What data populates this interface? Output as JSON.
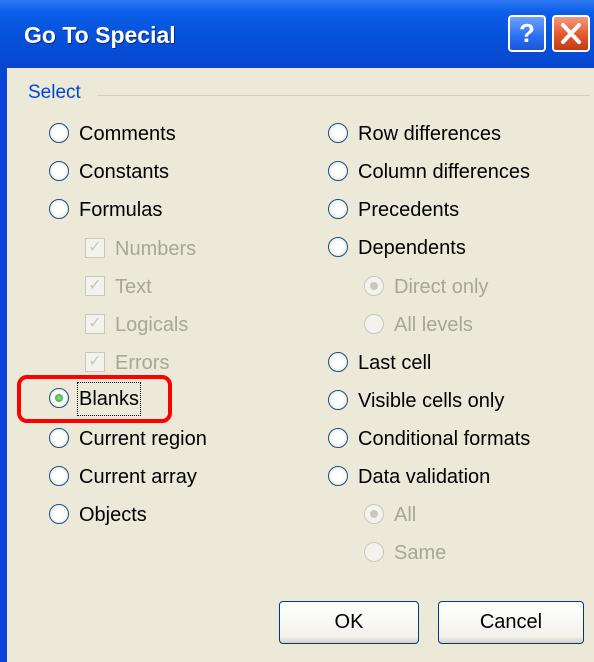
{
  "window": {
    "title": "Go To Special",
    "help_label": "?",
    "close_label": "✕"
  },
  "group": {
    "label": "Select"
  },
  "left_options": [
    {
      "label": "Comments",
      "selected": false
    },
    {
      "label": "Constants",
      "selected": false
    },
    {
      "label": "Formulas",
      "selected": false
    },
    {
      "label": "Numbers",
      "checked": true,
      "disabled": true
    },
    {
      "label": "Text",
      "checked": true,
      "disabled": true
    },
    {
      "label": "Logicals",
      "checked": true,
      "disabled": true
    },
    {
      "label": "Errors",
      "checked": true,
      "disabled": true
    },
    {
      "label": "Blanks",
      "selected": true
    },
    {
      "label": "Current region",
      "selected": false
    },
    {
      "label": "Current array",
      "selected": false
    },
    {
      "label": "Objects",
      "selected": false
    }
  ],
  "right_options": [
    {
      "label": "Row differences",
      "selected": false
    },
    {
      "label": "Column differences",
      "selected": false
    },
    {
      "label": "Precedents",
      "selected": false
    },
    {
      "label": "Dependents",
      "selected": false
    },
    {
      "label": "Direct only",
      "selected": true,
      "disabled": true
    },
    {
      "label": "All levels",
      "selected": false,
      "disabled": true
    },
    {
      "label": "Last cell",
      "selected": false
    },
    {
      "label": "Visible cells only",
      "selected": false
    },
    {
      "label": "Conditional formats",
      "selected": false
    },
    {
      "label": "Data validation",
      "selected": false
    },
    {
      "label": "All",
      "selected": true,
      "disabled": true
    },
    {
      "label": "Same",
      "selected": false,
      "disabled": true
    }
  ],
  "buttons": {
    "ok": "OK",
    "cancel": "Cancel"
  },
  "colors": {
    "title_bar": "#0a5ee8",
    "dialog_bg": "#ece9d8",
    "group_label": "#0046d5",
    "highlight": "#ff0000"
  }
}
